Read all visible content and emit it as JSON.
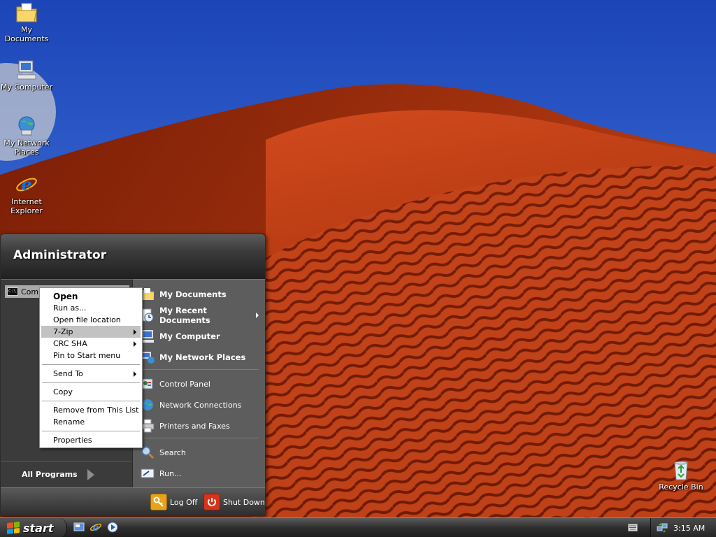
{
  "desktop": {
    "icons": [
      {
        "label": "My Documents",
        "icon": "my-documents-icon"
      },
      {
        "label": "My Computer",
        "icon": "my-computer-icon"
      },
      {
        "label": "My Network Places",
        "icon": "network-places-icon"
      },
      {
        "label": "Internet Explorer",
        "icon": "internet-explorer-icon"
      },
      {
        "label": "Recycle Bin",
        "icon": "recycle-bin-icon"
      }
    ]
  },
  "start_menu": {
    "user_name": "Administrator",
    "pinned": [
      {
        "label": "Comm",
        "icon": "command-prompt-icon"
      }
    ],
    "all_programs": "All Programs",
    "right_items": [
      {
        "label": "My Documents",
        "icon": "my-documents-icon"
      },
      {
        "label": "My Recent Documents",
        "icon": "recent-documents-icon"
      },
      {
        "label": "My Computer",
        "icon": "my-computer-icon"
      },
      {
        "label": "My Network Places",
        "icon": "network-places-icon"
      },
      {
        "label": "Control Panel",
        "icon": "control-panel-icon"
      },
      {
        "label": "Network Connections",
        "icon": "network-connections-icon"
      },
      {
        "label": "Printers and Faxes",
        "icon": "printer-icon"
      },
      {
        "label": "Search",
        "icon": "search-icon"
      },
      {
        "label": "Run...",
        "icon": "run-icon"
      }
    ],
    "log_off": "Log Off",
    "shut_down": "Shut Down"
  },
  "context_menu": {
    "items": [
      {
        "label": "Open"
      },
      {
        "label": "Run as..."
      },
      {
        "label": "Open file location"
      },
      {
        "label": "7-Zip"
      },
      {
        "label": "CRC SHA"
      },
      {
        "label": "Pin to Start menu"
      },
      {
        "label": "Send To"
      },
      {
        "label": "Copy"
      },
      {
        "label": "Remove from This List"
      },
      {
        "label": "Rename"
      },
      {
        "label": "Properties"
      }
    ]
  },
  "taskbar": {
    "start_label": "start",
    "clock": "3:15 AM"
  },
  "colors": {
    "sky": "#1f4fc2",
    "dune": "#c2421a",
    "menu_highlight": "#c2c2c2",
    "taskbar": "#2e2e2e"
  }
}
